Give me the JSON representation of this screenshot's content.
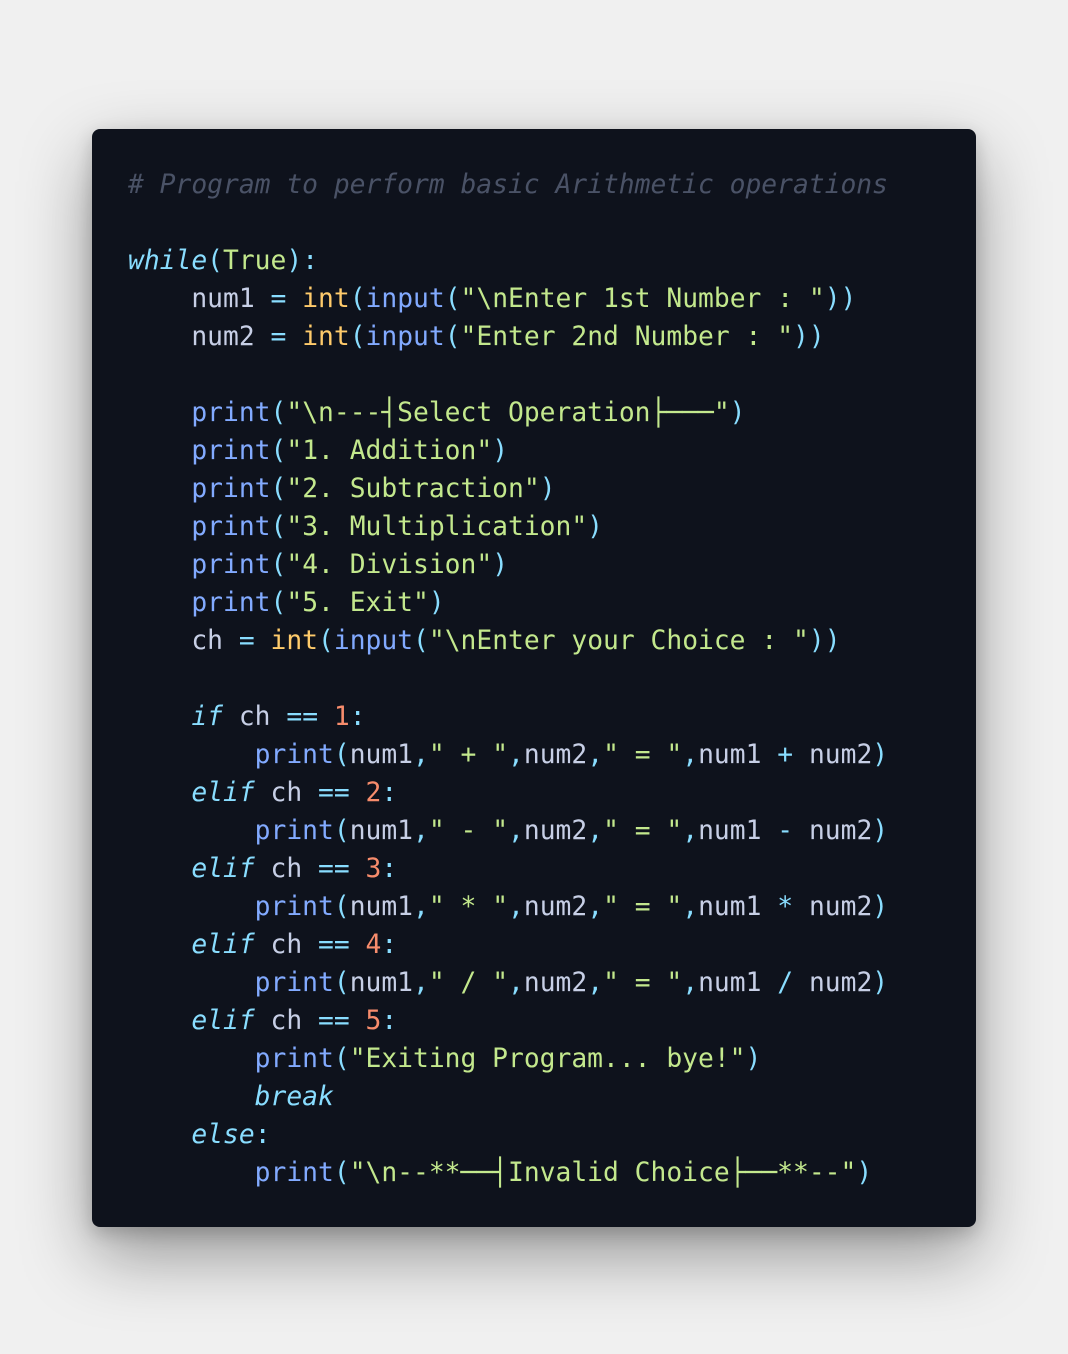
{
  "colors": {
    "background": "#f0f0f0",
    "card": "#0e121c",
    "comment": "#4a5266",
    "keyword": "#89ddff",
    "builtin": "#82aaff",
    "type": "#ffcb6b",
    "string": "#c3e88d",
    "number": "#f78c6c",
    "identifier": "#c7cfe6"
  },
  "code": {
    "lines": [
      [
        [
          "comment",
          "# Program to perform basic Arithmetic operations"
        ]
      ],
      [],
      [
        [
          "keyword",
          "while"
        ],
        [
          "punct",
          "("
        ],
        [
          "const",
          "True"
        ],
        [
          "punct",
          "):"
        ]
      ],
      [
        [
          "ident",
          "    num1 "
        ],
        [
          "op",
          "="
        ],
        [
          "ident",
          " "
        ],
        [
          "type",
          "int"
        ],
        [
          "punct",
          "("
        ],
        [
          "builtin",
          "input"
        ],
        [
          "punct",
          "("
        ],
        [
          "string",
          "\"\\nEnter 1st Number : \""
        ],
        [
          "punct",
          "))"
        ]
      ],
      [
        [
          "ident",
          "    num2 "
        ],
        [
          "op",
          "="
        ],
        [
          "ident",
          " "
        ],
        [
          "type",
          "int"
        ],
        [
          "punct",
          "("
        ],
        [
          "builtin",
          "input"
        ],
        [
          "punct",
          "("
        ],
        [
          "string",
          "\"Enter 2nd Number : \""
        ],
        [
          "punct",
          "))"
        ]
      ],
      [],
      [
        [
          "ident",
          "    "
        ],
        [
          "builtin",
          "print"
        ],
        [
          "punct",
          "("
        ],
        [
          "string",
          "\"\\n---┤Select Operation├───\""
        ],
        [
          "punct",
          ")"
        ]
      ],
      [
        [
          "ident",
          "    "
        ],
        [
          "builtin",
          "print"
        ],
        [
          "punct",
          "("
        ],
        [
          "string",
          "\"1. Addition\""
        ],
        [
          "punct",
          ")"
        ]
      ],
      [
        [
          "ident",
          "    "
        ],
        [
          "builtin",
          "print"
        ],
        [
          "punct",
          "("
        ],
        [
          "string",
          "\"2. Subtraction\""
        ],
        [
          "punct",
          ")"
        ]
      ],
      [
        [
          "ident",
          "    "
        ],
        [
          "builtin",
          "print"
        ],
        [
          "punct",
          "("
        ],
        [
          "string",
          "\"3. Multiplication\""
        ],
        [
          "punct",
          ")"
        ]
      ],
      [
        [
          "ident",
          "    "
        ],
        [
          "builtin",
          "print"
        ],
        [
          "punct",
          "("
        ],
        [
          "string",
          "\"4. Division\""
        ],
        [
          "punct",
          ")"
        ]
      ],
      [
        [
          "ident",
          "    "
        ],
        [
          "builtin",
          "print"
        ],
        [
          "punct",
          "("
        ],
        [
          "string",
          "\"5. Exit\""
        ],
        [
          "punct",
          ")"
        ]
      ],
      [
        [
          "ident",
          "    ch "
        ],
        [
          "op",
          "="
        ],
        [
          "ident",
          " "
        ],
        [
          "type",
          "int"
        ],
        [
          "punct",
          "("
        ],
        [
          "builtin",
          "input"
        ],
        [
          "punct",
          "("
        ],
        [
          "string",
          "\"\\nEnter your Choice : \""
        ],
        [
          "punct",
          "))"
        ]
      ],
      [],
      [
        [
          "ident",
          "    "
        ],
        [
          "keyword",
          "if"
        ],
        [
          "ident",
          " ch "
        ],
        [
          "op",
          "=="
        ],
        [
          "ident",
          " "
        ],
        [
          "number",
          "1"
        ],
        [
          "punct",
          ":"
        ]
      ],
      [
        [
          "ident",
          "        "
        ],
        [
          "builtin",
          "print"
        ],
        [
          "punct",
          "("
        ],
        [
          "ident",
          "num1"
        ],
        [
          "punct",
          ","
        ],
        [
          "string",
          "\" + \""
        ],
        [
          "punct",
          ","
        ],
        [
          "ident",
          "num2"
        ],
        [
          "punct",
          ","
        ],
        [
          "string",
          "\" = \""
        ],
        [
          "punct",
          ","
        ],
        [
          "ident",
          "num1 "
        ],
        [
          "op",
          "+"
        ],
        [
          "ident",
          " num2"
        ],
        [
          "punct",
          ")"
        ]
      ],
      [
        [
          "ident",
          "    "
        ],
        [
          "keyword",
          "elif"
        ],
        [
          "ident",
          " ch "
        ],
        [
          "op",
          "=="
        ],
        [
          "ident",
          " "
        ],
        [
          "number",
          "2"
        ],
        [
          "punct",
          ":"
        ]
      ],
      [
        [
          "ident",
          "        "
        ],
        [
          "builtin",
          "print"
        ],
        [
          "punct",
          "("
        ],
        [
          "ident",
          "num1"
        ],
        [
          "punct",
          ","
        ],
        [
          "string",
          "\" - \""
        ],
        [
          "punct",
          ","
        ],
        [
          "ident",
          "num2"
        ],
        [
          "punct",
          ","
        ],
        [
          "string",
          "\" = \""
        ],
        [
          "punct",
          ","
        ],
        [
          "ident",
          "num1 "
        ],
        [
          "op",
          "-"
        ],
        [
          "ident",
          " num2"
        ],
        [
          "punct",
          ")"
        ]
      ],
      [
        [
          "ident",
          "    "
        ],
        [
          "keyword",
          "elif"
        ],
        [
          "ident",
          " ch "
        ],
        [
          "op",
          "=="
        ],
        [
          "ident",
          " "
        ],
        [
          "number",
          "3"
        ],
        [
          "punct",
          ":"
        ]
      ],
      [
        [
          "ident",
          "        "
        ],
        [
          "builtin",
          "print"
        ],
        [
          "punct",
          "("
        ],
        [
          "ident",
          "num1"
        ],
        [
          "punct",
          ","
        ],
        [
          "string",
          "\" * \""
        ],
        [
          "punct",
          ","
        ],
        [
          "ident",
          "num2"
        ],
        [
          "punct",
          ","
        ],
        [
          "string",
          "\" = \""
        ],
        [
          "punct",
          ","
        ],
        [
          "ident",
          "num1 "
        ],
        [
          "op",
          "*"
        ],
        [
          "ident",
          " num2"
        ],
        [
          "punct",
          ")"
        ]
      ],
      [
        [
          "ident",
          "    "
        ],
        [
          "keyword",
          "elif"
        ],
        [
          "ident",
          " ch "
        ],
        [
          "op",
          "=="
        ],
        [
          "ident",
          " "
        ],
        [
          "number",
          "4"
        ],
        [
          "punct",
          ":"
        ]
      ],
      [
        [
          "ident",
          "        "
        ],
        [
          "builtin",
          "print"
        ],
        [
          "punct",
          "("
        ],
        [
          "ident",
          "num1"
        ],
        [
          "punct",
          ","
        ],
        [
          "string",
          "\" / \""
        ],
        [
          "punct",
          ","
        ],
        [
          "ident",
          "num2"
        ],
        [
          "punct",
          ","
        ],
        [
          "string",
          "\" = \""
        ],
        [
          "punct",
          ","
        ],
        [
          "ident",
          "num1 "
        ],
        [
          "op",
          "/"
        ],
        [
          "ident",
          " num2"
        ],
        [
          "punct",
          ")"
        ]
      ],
      [
        [
          "ident",
          "    "
        ],
        [
          "keyword",
          "elif"
        ],
        [
          "ident",
          " ch "
        ],
        [
          "op",
          "=="
        ],
        [
          "ident",
          " "
        ],
        [
          "number",
          "5"
        ],
        [
          "punct",
          ":"
        ]
      ],
      [
        [
          "ident",
          "        "
        ],
        [
          "builtin",
          "print"
        ],
        [
          "punct",
          "("
        ],
        [
          "string",
          "\"Exiting Program... bye!\""
        ],
        [
          "punct",
          ")"
        ]
      ],
      [
        [
          "ident",
          "        "
        ],
        [
          "keyword",
          "break"
        ]
      ],
      [
        [
          "ident",
          "    "
        ],
        [
          "keyword",
          "else"
        ],
        [
          "punct",
          ":"
        ]
      ],
      [
        [
          "ident",
          "        "
        ],
        [
          "builtin",
          "print"
        ],
        [
          "punct",
          "("
        ],
        [
          "string",
          "\"\\n--**──┤Invalid Choice├──**--\""
        ],
        [
          "punct",
          ")"
        ]
      ]
    ]
  }
}
